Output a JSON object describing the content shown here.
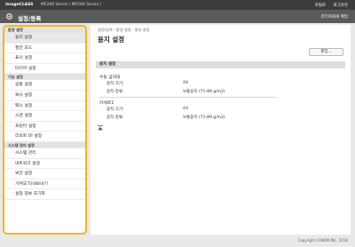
{
  "header": {
    "brand": "imageCLASS",
    "model": "MF266 Series / MF266 Series /",
    "links": [
      "포털로",
      "로그아웃"
    ],
    "page_title": "설정/등록",
    "admin_label": "관리자에게 메일"
  },
  "sidebar": {
    "sections": [
      {
        "title": "환경 설정",
        "items": [
          "용지 설정",
          "절전 모드",
          "표시 설정",
          "타이머 설정"
        ]
      },
      {
        "title": "기능 설정",
        "items": [
          "공통 설정",
          "복사 설정",
          "팩스 설정",
          "스캔 설정",
          "프린터 설정",
          "리모트 UI 설정"
        ]
      },
      {
        "title": "시스템 관리 설정",
        "items": [
          "시스템 관리",
          "네트워크 설정",
          "보안 설정",
          "가져오기/내보내기",
          "설정 정보 초기화"
        ]
      }
    ]
  },
  "main": {
    "breadcrumb": "설정/등록 : 환경 설정 : 용지 설정",
    "title": "용지 설정",
    "edit_button": "편집...",
    "section_title": "용지 설정",
    "groups": [
      {
        "name": "수동 급지대",
        "rows": [
          {
            "label": "용지 크기:",
            "value": "A4"
          },
          {
            "label": "용지 종류:",
            "value": "보통용지 (71-89 g/m2)"
          }
        ]
      },
      {
        "name": "카세트1",
        "rows": [
          {
            "label": "용지 크기:",
            "value": "A4"
          },
          {
            "label": "용지 종류:",
            "value": "보통용지 (71-89 g/m2)"
          }
        ]
      }
    ]
  },
  "footer": {
    "copyright": "Copyright CANON INC. 2016"
  }
}
